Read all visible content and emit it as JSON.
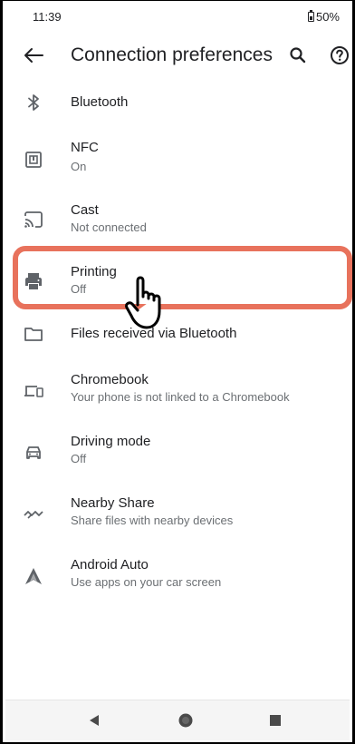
{
  "status_bar": {
    "time": "11:39",
    "battery": "50%"
  },
  "app_bar": {
    "title": "Connection preferences",
    "icons": [
      "back-arrow-icon",
      "search-icon",
      "help-icon"
    ]
  },
  "items": [
    {
      "title": "Bluetooth",
      "subtitle": "",
      "icon": "bluetooth-icon"
    },
    {
      "title": "NFC",
      "subtitle": "On",
      "icon": "nfc-icon"
    },
    {
      "title": "Cast",
      "subtitle": "Not connected",
      "icon": "cast-icon"
    },
    {
      "title": "Printing",
      "subtitle": "Off",
      "icon": "printer-icon"
    },
    {
      "title": "Files received via Bluetooth",
      "subtitle": "",
      "icon": "folder-icon"
    },
    {
      "title": "Chromebook",
      "subtitle": "Your phone is not linked to a Chromebook",
      "icon": "chromebook-icon"
    },
    {
      "title": "Driving mode",
      "subtitle": "Off",
      "icon": "car-icon"
    },
    {
      "title": "Nearby Share",
      "subtitle": "Share files with nearby devices",
      "icon": "nearby-share-icon"
    },
    {
      "title": "Android Auto",
      "subtitle": "Use apps on your car screen",
      "icon": "android-auto-icon"
    }
  ],
  "highlight_color": "#e8725c",
  "nav_bar": {
    "icons": [
      "nav-back-icon",
      "nav-home-icon",
      "nav-recents-icon"
    ]
  }
}
